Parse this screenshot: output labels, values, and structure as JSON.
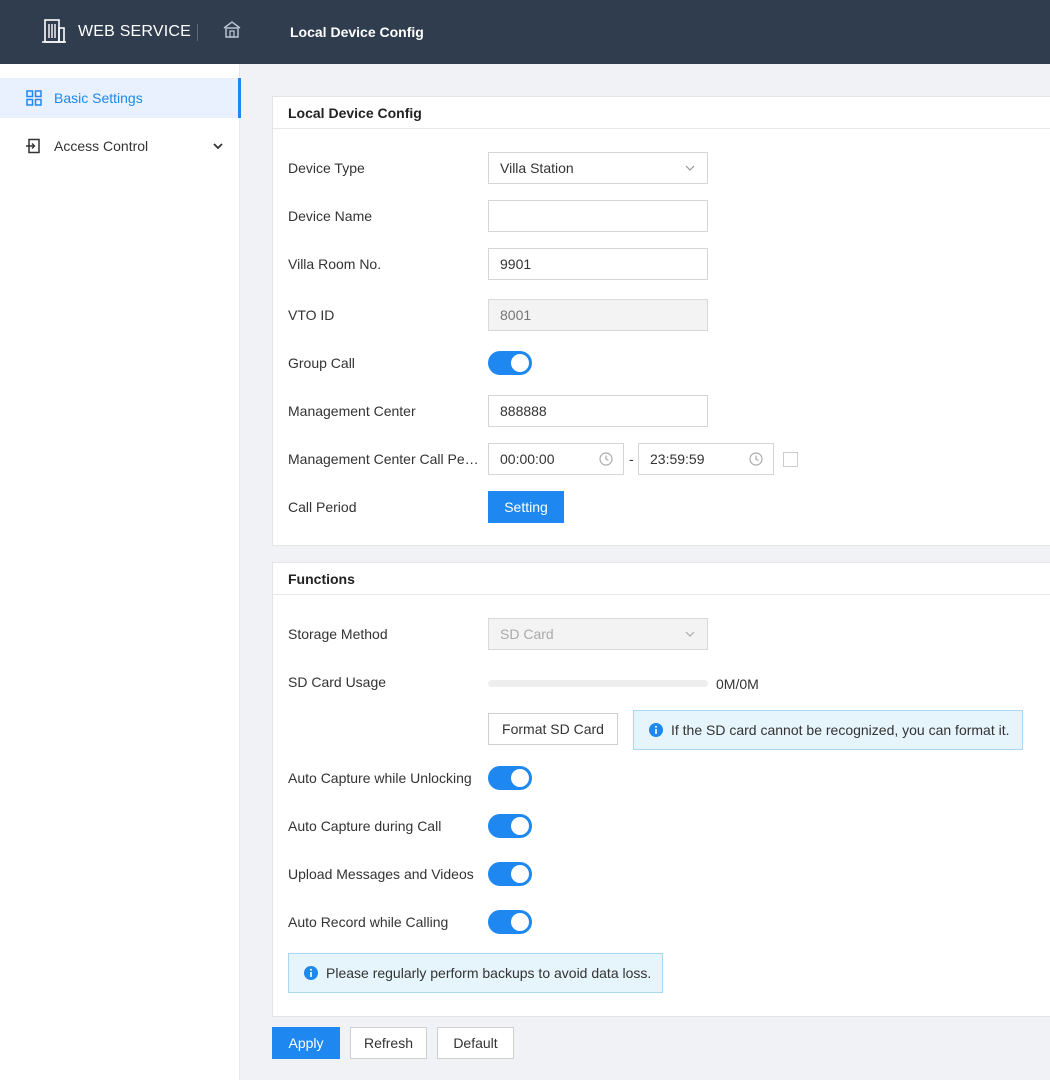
{
  "header": {
    "brand": "WEB SERVICE",
    "breadcrumb": "Local Device Config"
  },
  "sidebar": {
    "items": [
      {
        "label": "Basic Settings",
        "icon": "grid-icon",
        "active": true
      },
      {
        "label": "Access Control",
        "icon": "door-icon",
        "active": false
      }
    ]
  },
  "config": {
    "title": "Local Device Config",
    "device_type": {
      "label": "Device Type",
      "value": "Villa Station"
    },
    "device_name": {
      "label": "Device Name",
      "value": ""
    },
    "room_no": {
      "label": "Villa Room No.",
      "value": "9901"
    },
    "vto_id": {
      "label": "VTO ID",
      "placeholder": "8001"
    },
    "group_call": {
      "label": "Group Call",
      "on": true
    },
    "mgmt_center": {
      "label": "Management Center",
      "value": "888888"
    },
    "call_period": {
      "label": "Management Center Call Period",
      "label_shown": "Management Center Call Peri...",
      "start": "00:00:00",
      "end": "23:59:59",
      "separator": "-"
    },
    "call_period_setting": {
      "label": "Call Period",
      "button": "Setting"
    }
  },
  "functions": {
    "title": "Functions",
    "storage": {
      "label": "Storage Method",
      "value": "SD Card"
    },
    "sd_usage": {
      "label": "SD Card Usage",
      "text": "0M/0M",
      "fraction": 0
    },
    "format_button": "Format SD Card",
    "format_tip": "If the SD card cannot be recognized, you can format it.",
    "toggles": [
      {
        "label": "Auto Capture while Unlocking",
        "on": true
      },
      {
        "label": "Auto Capture during Call",
        "on": true
      },
      {
        "label": "Upload Messages and Videos",
        "on": true
      },
      {
        "label": "Auto Record while Calling",
        "on": true
      }
    ],
    "backup_tip": "Please regularly perform backups to avoid data loss."
  },
  "actions": {
    "apply": "Apply",
    "refresh": "Refresh",
    "default": "Default"
  },
  "colors": {
    "header_bg": "#2f3d4f",
    "accent": "#1e88f0",
    "tip_bg": "#e6f4fc"
  }
}
